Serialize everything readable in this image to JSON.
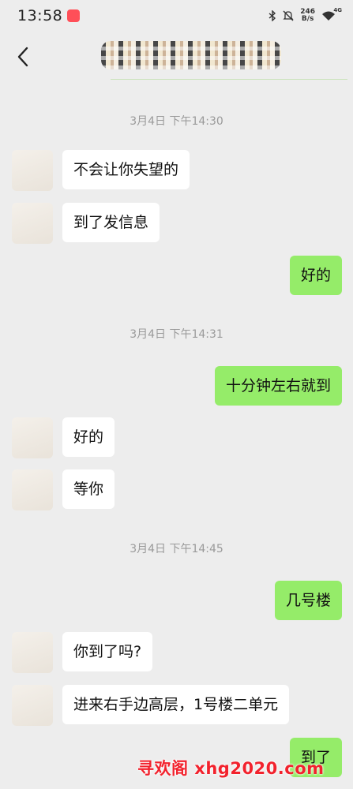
{
  "status_bar": {
    "time": "13:58",
    "net_speed_value": "246",
    "net_speed_unit": "B/s",
    "signal_label": "4G",
    "icons": [
      "app-notification-icon",
      "bluetooth-icon",
      "mute-icon",
      "wifi-icon"
    ]
  },
  "header": {
    "back_icon": "chevron-left-icon",
    "contact_name": "(pixelated name)"
  },
  "messages": [
    {
      "type": "time",
      "text": "3月4日 下午14:30"
    },
    {
      "type": "msg",
      "side": "left",
      "text": "不会让你失望的"
    },
    {
      "type": "msg",
      "side": "left",
      "text": "到了发信息"
    },
    {
      "type": "msg",
      "side": "right",
      "text": "好的"
    },
    {
      "type": "time",
      "text": "3月4日 下午14:31"
    },
    {
      "type": "msg",
      "side": "right",
      "text": "十分钟左右就到"
    },
    {
      "type": "msg",
      "side": "left",
      "text": "好的"
    },
    {
      "type": "msg",
      "side": "left",
      "text": "等你"
    },
    {
      "type": "time",
      "text": "3月4日 下午14:45"
    },
    {
      "type": "msg",
      "side": "right",
      "text": "几号楼"
    },
    {
      "type": "msg",
      "side": "left",
      "text": "你到了吗?"
    },
    {
      "type": "msg",
      "side": "left",
      "text": "进来右手边高层，1号楼二单元"
    },
    {
      "type": "msg",
      "side": "right",
      "text": "到了"
    }
  ],
  "watermark": "寻欢阁 xhg2020.com",
  "colors": {
    "background": "#ededed",
    "bubble_left": "#ffffff",
    "bubble_right": "#95ec69",
    "timestamp": "#9a9a9a",
    "watermark": "#f2222d"
  }
}
